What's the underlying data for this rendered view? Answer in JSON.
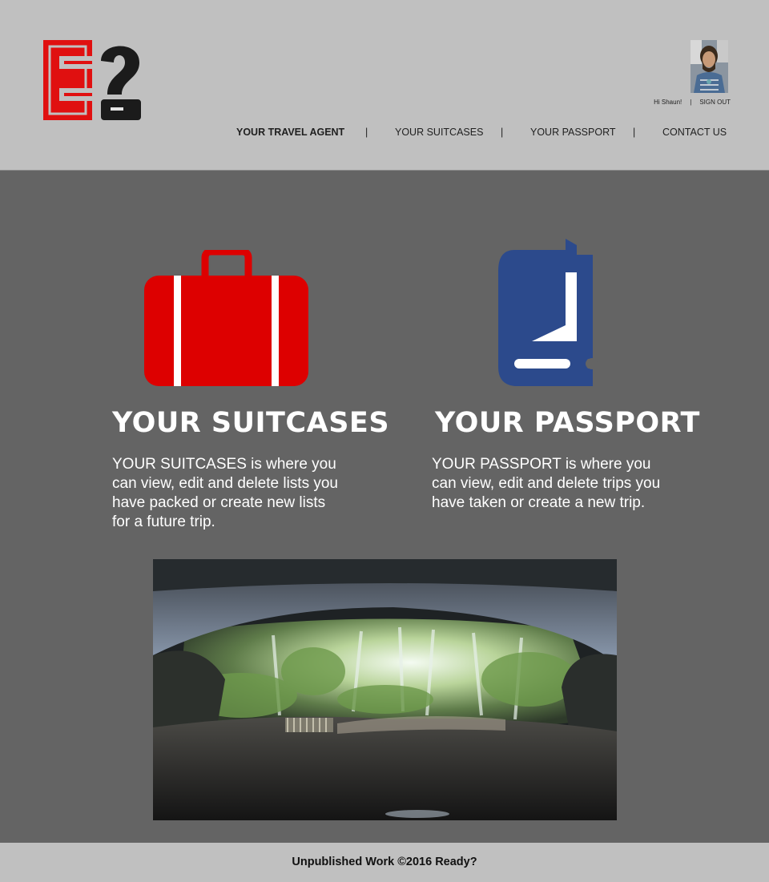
{
  "header": {
    "logo_alt": "E?",
    "user": {
      "greeting": "Hi Shaun!",
      "separator": "|",
      "sign_out_label": "SIGN OUT"
    },
    "nav": {
      "items": [
        {
          "label": "YOUR TRAVEL AGENT",
          "active": true
        },
        {
          "label": "YOUR SUITCASES"
        },
        {
          "label": "YOUR PASSPORT"
        },
        {
          "label": "CONTACT US"
        }
      ],
      "separator": "|"
    }
  },
  "features": {
    "suitcases": {
      "icon": "suitcase-icon",
      "title": "YOUR SUITCASES",
      "description": "YOUR SUITCASES is where you can view, edit and delete lists you have packed or create new lists for a future trip."
    },
    "passport": {
      "icon": "passport-icon",
      "title": "YOUR PASSPORT",
      "description": "YOUR PASSPORT is where you can view, edit and delete trips you have taken or create a new trip."
    }
  },
  "footer": {
    "text": "Unpublished Work ©2016 Ready?"
  },
  "colors": {
    "header_bg": "#c0c0c0",
    "body_bg": "#646464",
    "logo_red": "#e01010",
    "suitcase_red": "#dd0000",
    "passport_blue": "#2c4a8c"
  }
}
